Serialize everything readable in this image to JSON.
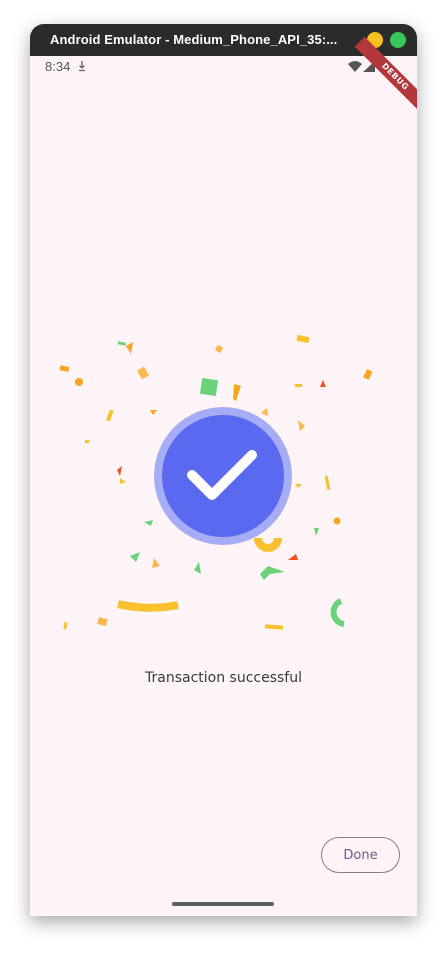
{
  "window": {
    "title": "Android Emulator - Medium_Phone_API_35:..."
  },
  "status_bar": {
    "time": "8:34",
    "icons": [
      "notification-download-icon",
      "wifi-icon",
      "cellular-signal-icon",
      "battery-icon"
    ]
  },
  "debug_banner": {
    "label": "DEBUG"
  },
  "success": {
    "icon": "checkmark-icon",
    "message": "Transaction successful"
  },
  "actions": {
    "done_label": "Done"
  },
  "colors": {
    "screen_background": "#fff4f7",
    "check_circle": "#5b69f0",
    "check_ring": "#a6acf6",
    "button_text": "#6c5a8f",
    "confetti": [
      "#f6a623",
      "#6cd27a",
      "#fbc02d",
      "#f4511e",
      "#ffb74d"
    ]
  }
}
